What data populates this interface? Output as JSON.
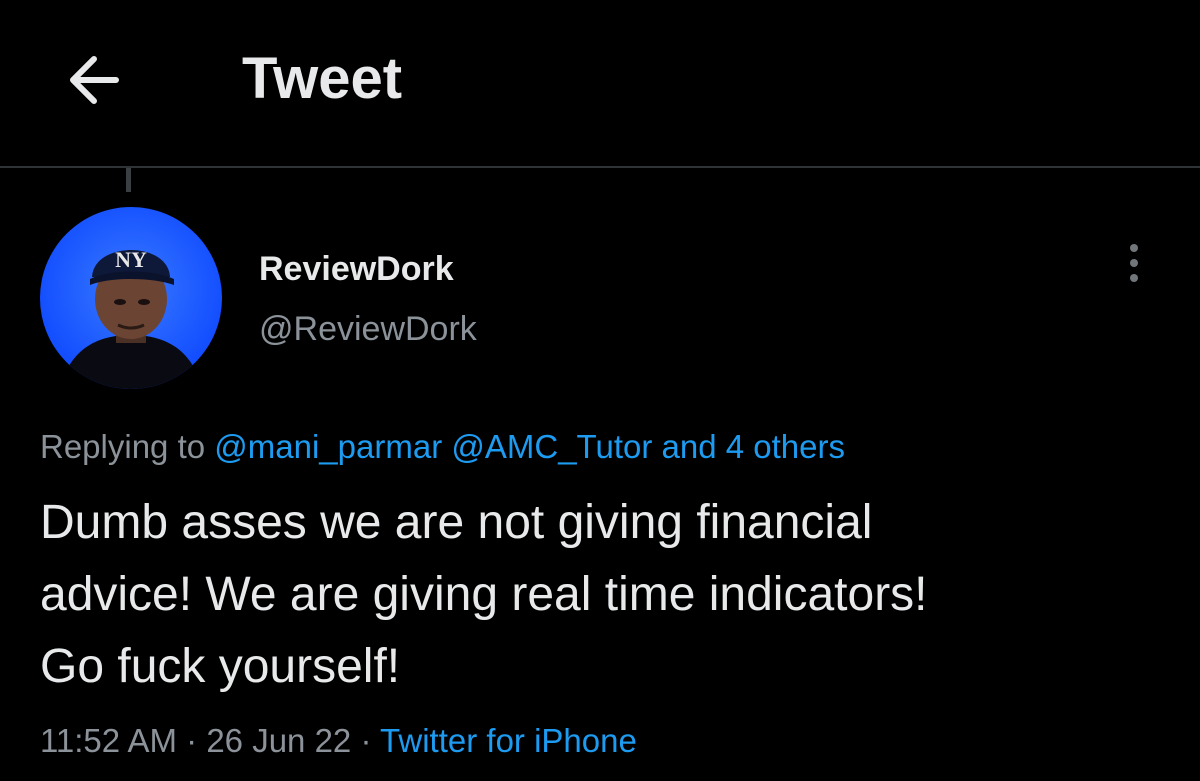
{
  "header": {
    "title": "Tweet",
    "back_icon": "arrow-left-icon"
  },
  "author": {
    "display_name": "ReviewDork",
    "handle": "@ReviewDork",
    "avatar_icon": "avatar-photo",
    "cap_logo": "NY"
  },
  "more_icon": "more-vertical-icon",
  "reply": {
    "prefix": "Replying to",
    "mention_1": "@mani_parmar",
    "mention_2": "@AMC_Tutor",
    "and_others": "and 4 others"
  },
  "tweet": {
    "lines": [
      "Dumb asses we are not giving financial",
      "advice! We are giving real time indicators!",
      "Go fuck yourself!"
    ]
  },
  "meta": {
    "time": "11:52 AM",
    "separator": "·",
    "date": "26 Jun 22",
    "source": "Twitter for iPhone"
  },
  "colors": {
    "background": "#000000",
    "text": "#e7e9ea",
    "secondary": "#8b9299",
    "link": "#1d9bf0",
    "avatar_bg": "#1a5cff"
  }
}
